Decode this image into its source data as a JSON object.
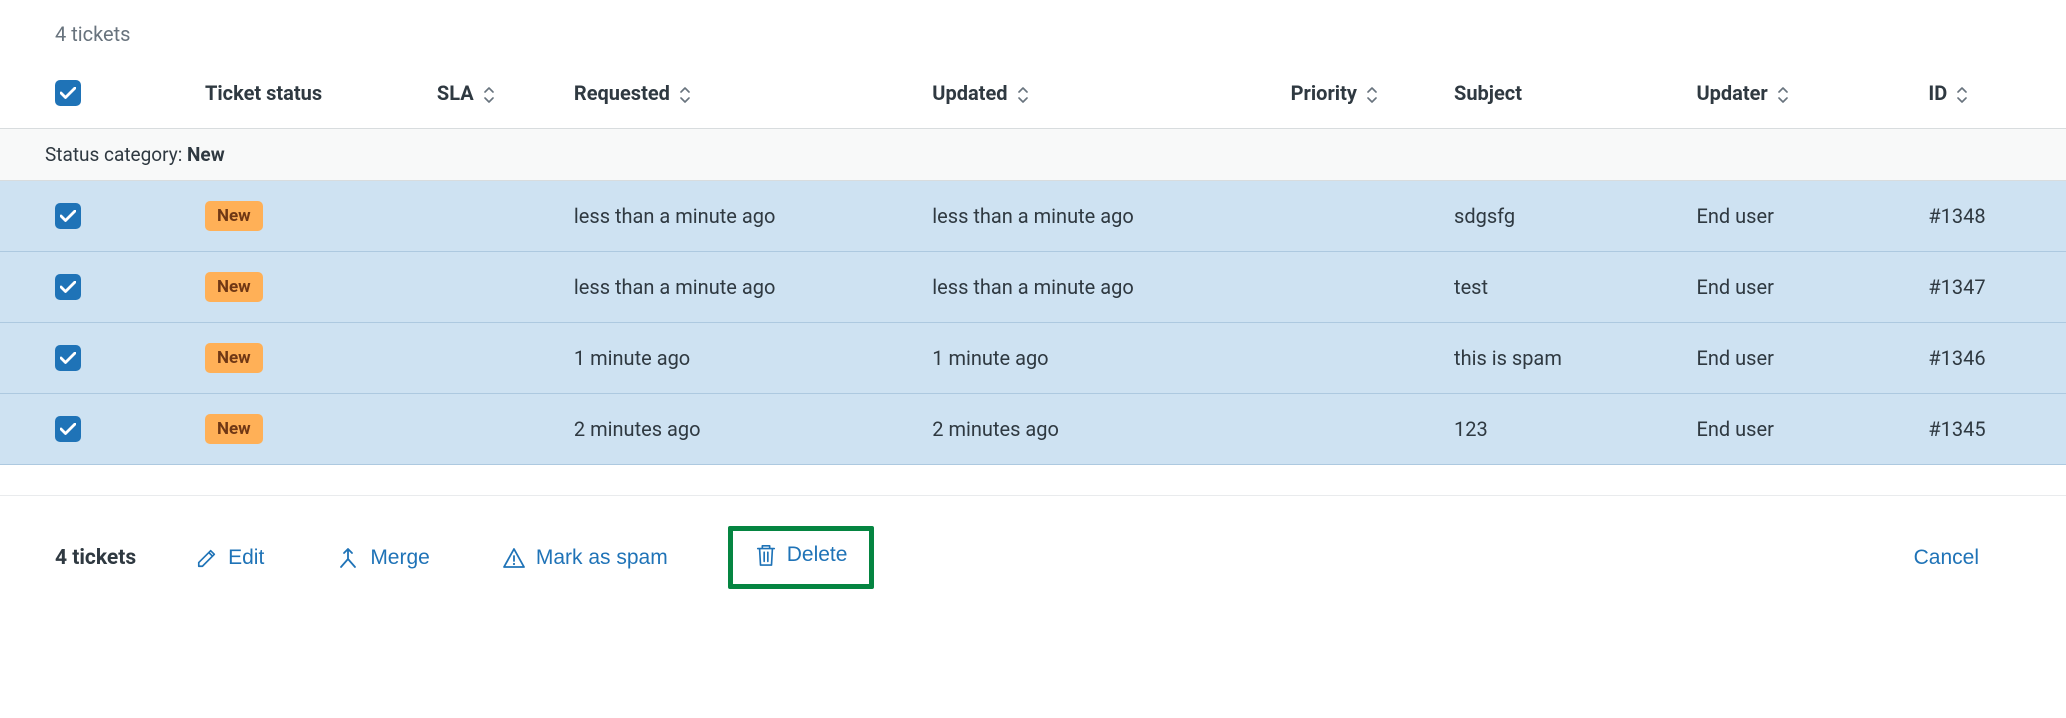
{
  "header": {
    "ticket_count_text": "4 tickets"
  },
  "columns": {
    "ticket_status": "Ticket status",
    "sla": "SLA",
    "requested": "Requested",
    "updated": "Updated",
    "priority": "Priority",
    "subject": "Subject",
    "updater": "Updater",
    "id": "ID"
  },
  "group": {
    "label": "Status category: ",
    "value": "New"
  },
  "rows": [
    {
      "status": "New",
      "sla": "",
      "requested": "less than a minute ago",
      "updated": "less than a minute ago",
      "priority": "",
      "subject": "sdgsfg",
      "updater": "End user",
      "id": "#1348"
    },
    {
      "status": "New",
      "sla": "",
      "requested": "less than a minute ago",
      "updated": "less than a minute ago",
      "priority": "",
      "subject": "test",
      "updater": "End user",
      "id": "#1347"
    },
    {
      "status": "New",
      "sla": "",
      "requested": "1 minute ago",
      "updated": "1 minute ago",
      "priority": "",
      "subject": "this is spam",
      "updater": "End user",
      "id": "#1346"
    },
    {
      "status": "New",
      "sla": "",
      "requested": "2 minutes ago",
      "updated": "2 minutes ago",
      "priority": "",
      "subject": "123",
      "updater": "End user",
      "id": "#1345"
    }
  ],
  "actions": {
    "selected_count": "4 tickets",
    "edit": "Edit",
    "merge": "Merge",
    "mark_spam": "Mark as spam",
    "delete": "Delete",
    "cancel": "Cancel"
  }
}
